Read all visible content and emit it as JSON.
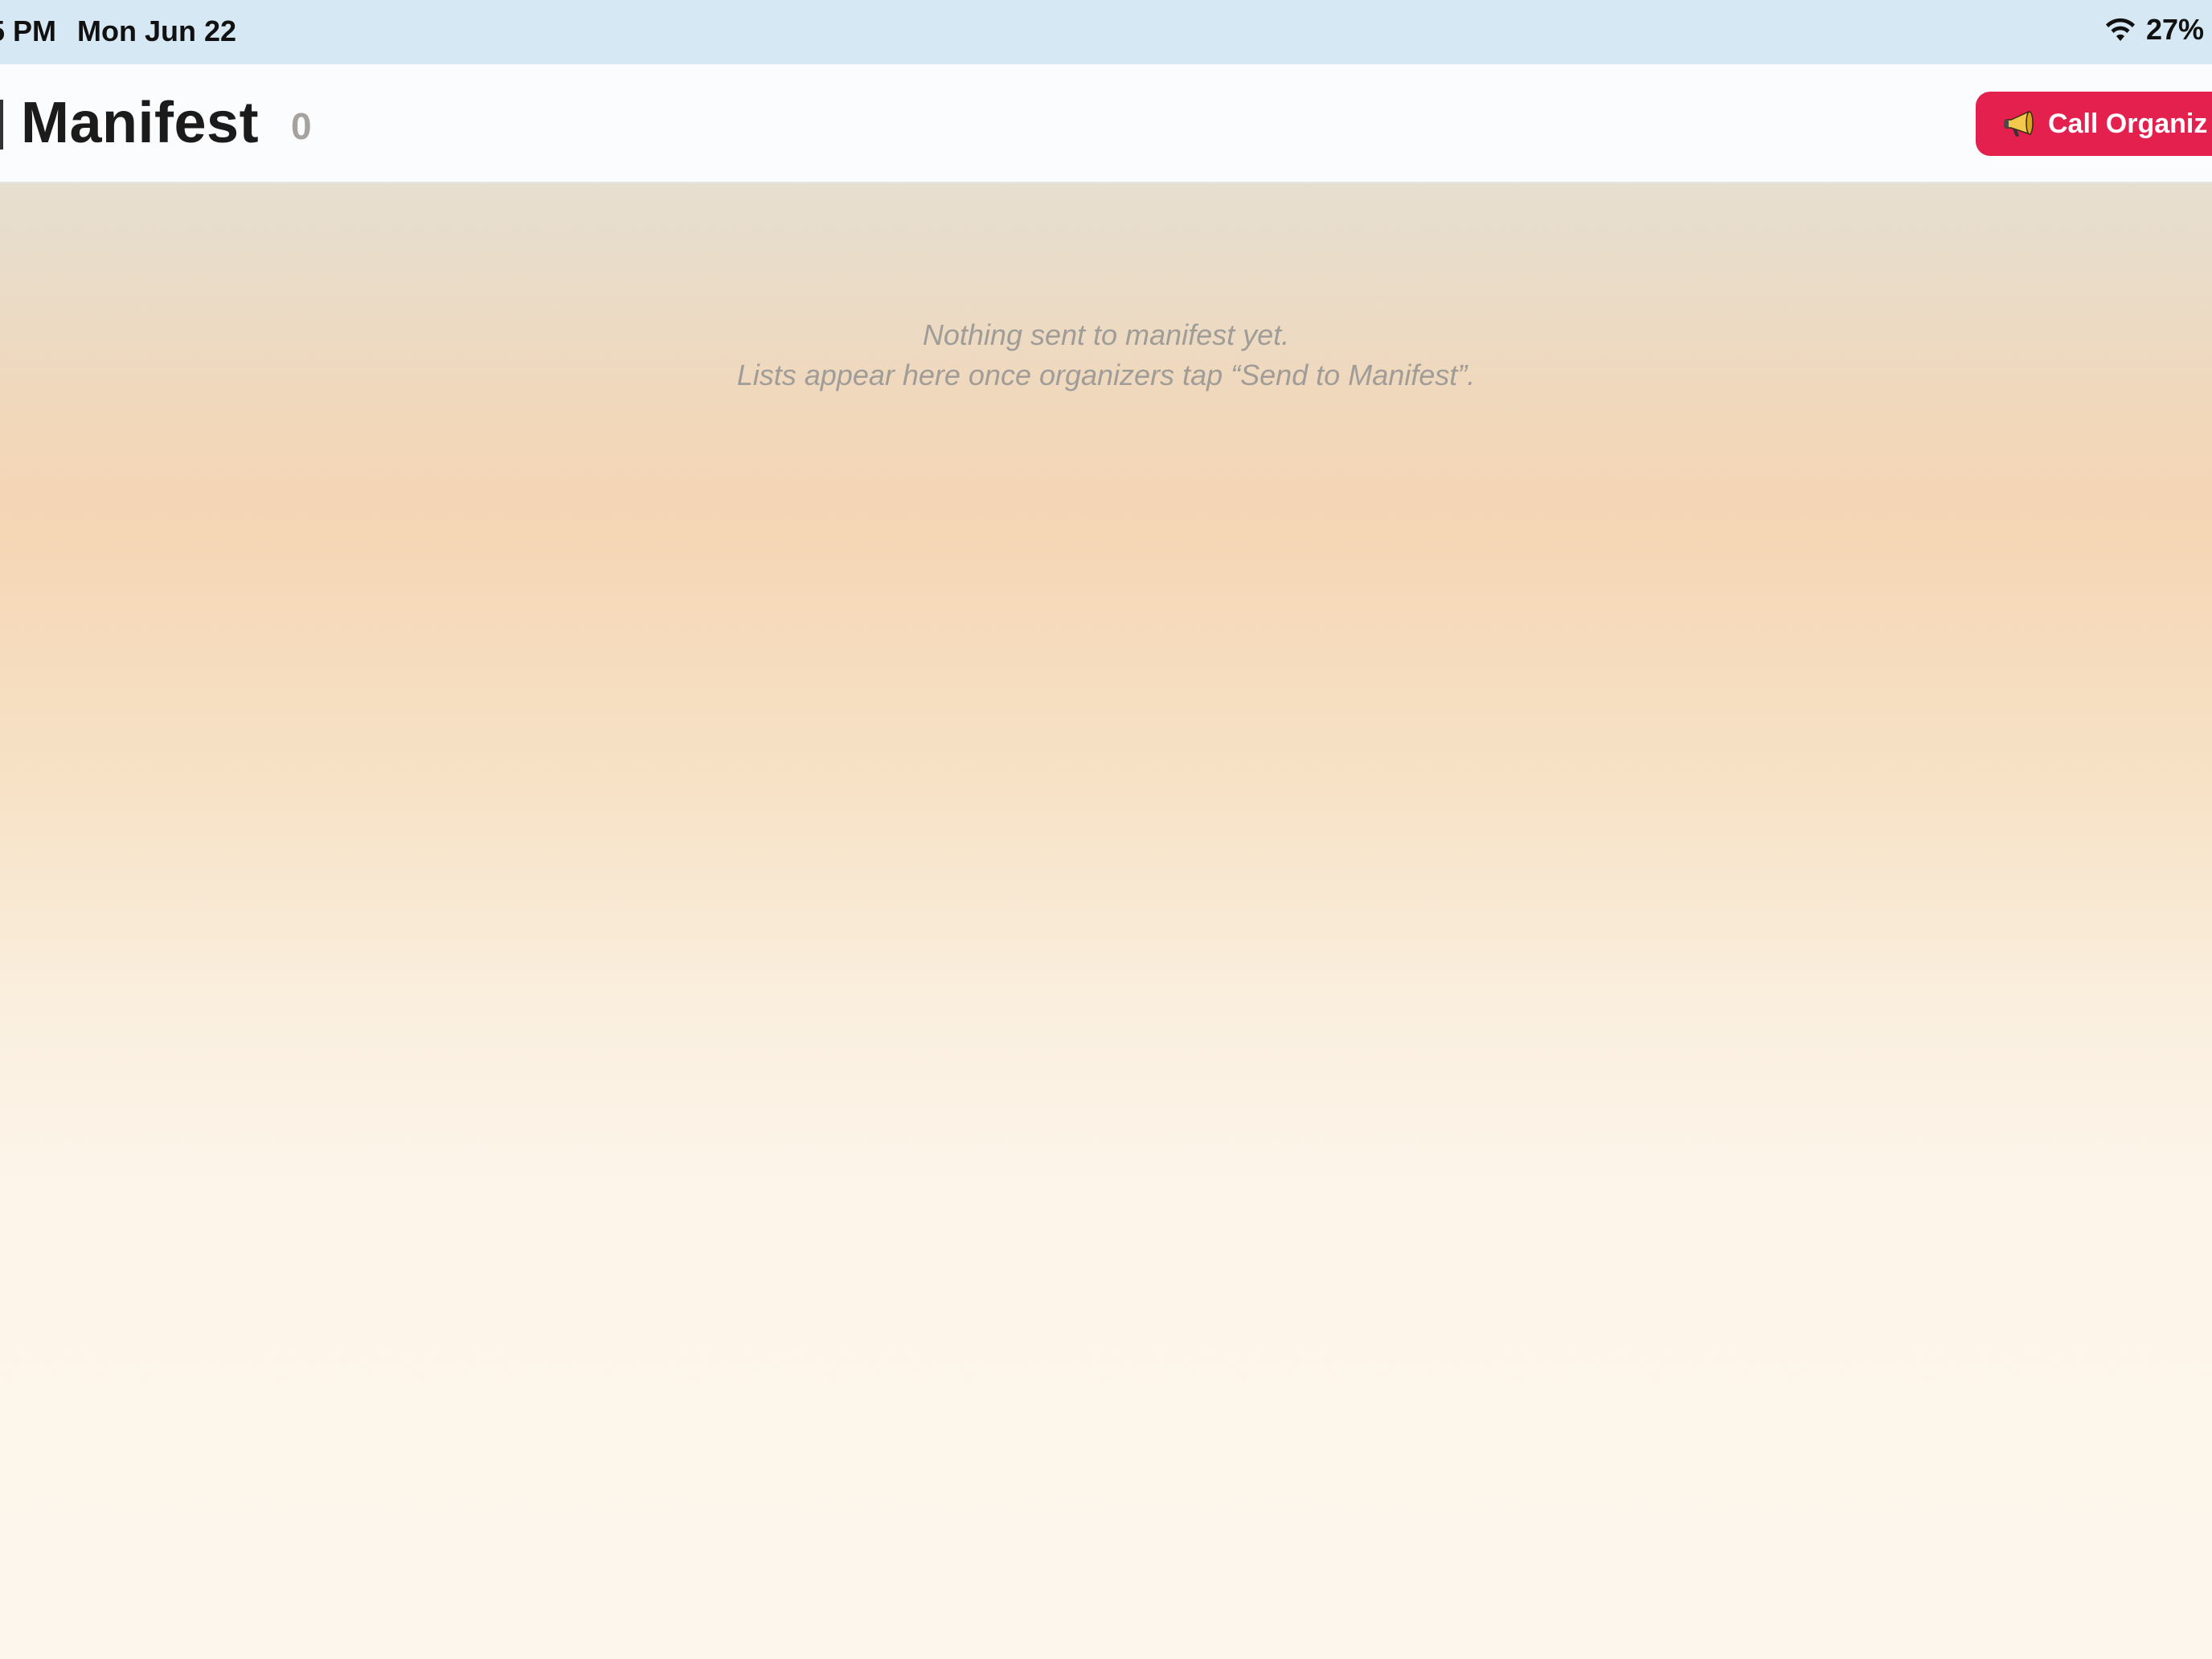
{
  "status_bar": {
    "time": "5 PM",
    "date": "Mon Jun 22",
    "battery": "27%",
    "wifi_icon": "wifi-icon"
  },
  "header": {
    "title": "Manifest",
    "count": "0",
    "call_button": {
      "icon": "megaphone-icon",
      "label": "Call Organiz"
    }
  },
  "empty_state": {
    "line1": "Nothing sent to manifest yet.",
    "line2": "Lists appear here once organizers tap “Send to Manifest”."
  },
  "colors": {
    "accent": "#e4204e",
    "status_bar_bg": "#d6e8f3",
    "header_bg": "#fbfcfd",
    "muted_text": "#a09c97"
  }
}
